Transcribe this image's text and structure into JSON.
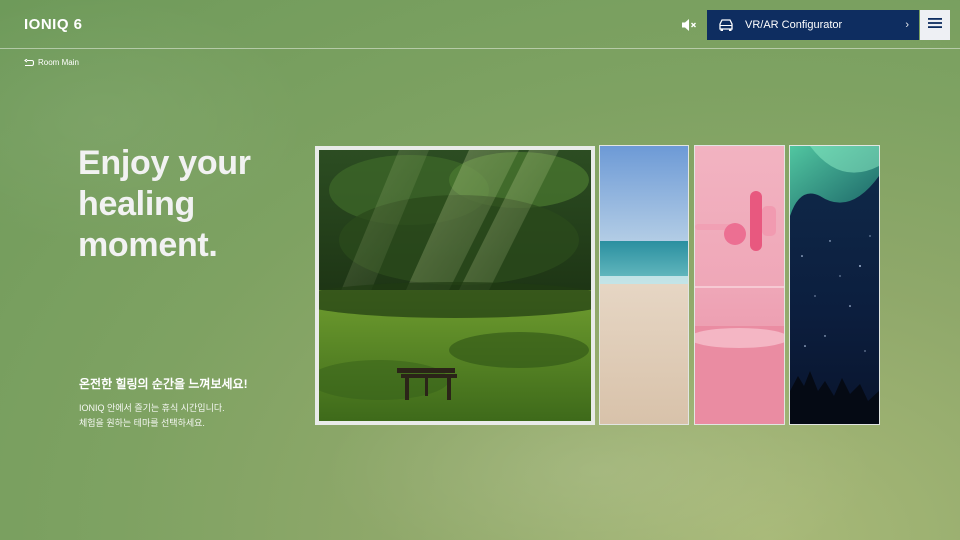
{
  "header": {
    "brand": "IONIQ 6",
    "configurator_label": "VR/AR Configurator",
    "configurator_chevron": "›",
    "icons": {
      "mute": "speaker-muted-icon",
      "car": "car-icon",
      "menu": "hamburger-menu-icon"
    }
  },
  "breadcrumb": {
    "label": "Room Main"
  },
  "hero": {
    "line1": "Enjoy your",
    "line2": "healing",
    "line3": "moment."
  },
  "intro": {
    "subheading": "온전한 힐링의 순간을 느껴보세요!",
    "desc_line1": "IONIQ 안에서 즐기는 휴식 시간입니다.",
    "desc_line2": "체험을 원하는 테마를 선택하세요."
  },
  "themes": {
    "selected": "forest",
    "items": [
      "forest",
      "beach",
      "pink-space",
      "aurora"
    ]
  },
  "colors": {
    "configurator_bg": "#0e2d60",
    "menu_bg": "#eef0f4",
    "background": "#7ea262"
  }
}
